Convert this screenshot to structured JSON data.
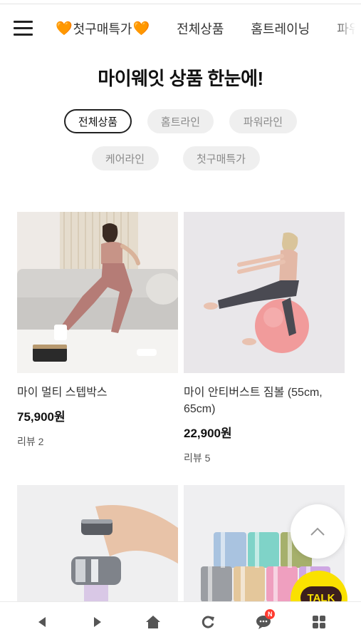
{
  "header": {
    "nav_items": [
      {
        "label": "첫구매특가",
        "has_hearts": true
      },
      {
        "label": "전체상품"
      },
      {
        "label": "홈트레이닝"
      },
      {
        "label": "파워"
      }
    ]
  },
  "page_title": "마이웨잇 상품 한눈에!",
  "filters": {
    "chips": [
      "전체상품",
      "홈트라인",
      "파워라인",
      "케어라인",
      "첫구매특가"
    ],
    "active": "전체상품"
  },
  "products": [
    {
      "name": "마이 멀티 스텝박스",
      "price": "75,900원",
      "review": "리뷰 2"
    },
    {
      "name": "마이 안티버스트 짐볼 (55cm, 65cm)",
      "price": "22,900원",
      "review": "리뷰 5"
    },
    {
      "name": "",
      "price": "",
      "review": ""
    },
    {
      "name": "",
      "price": "",
      "review": ""
    }
  ],
  "talk_button": {
    "label": "TALK"
  },
  "bottom_bar": {
    "icons": [
      "back-icon",
      "forward-icon",
      "home-icon",
      "refresh-icon",
      "chat-icon",
      "apps-icon"
    ],
    "badge": "N"
  },
  "colors": {
    "accent_heart": "#ff8a00",
    "talk_yellow": "#fae100",
    "badge_red": "#ff3b30"
  }
}
